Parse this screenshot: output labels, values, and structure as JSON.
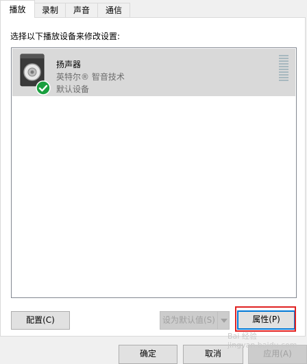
{
  "tabs": [
    {
      "label": "播放",
      "active": true
    },
    {
      "label": "录制",
      "active": false
    },
    {
      "label": "声音",
      "active": false
    },
    {
      "label": "通信",
      "active": false
    }
  ],
  "instruction": "选择以下播放设备来修改设置:",
  "device": {
    "name": "扬声器",
    "driver": "英特尔® 智音技术",
    "status": "默认设备",
    "icon": "speaker-icon",
    "status_icon": "default-check-icon",
    "status_color": "#1a9f3f",
    "selected": true
  },
  "buttons": {
    "configure": "配置(C)",
    "set_default": "设为默认值(S)",
    "properties": "属性(P)",
    "ok": "确定",
    "cancel": "取消",
    "apply": "应用(A)"
  },
  "highlight_color": "#e02020",
  "watermark": "Bai 经验 jingyan.baidu.com"
}
